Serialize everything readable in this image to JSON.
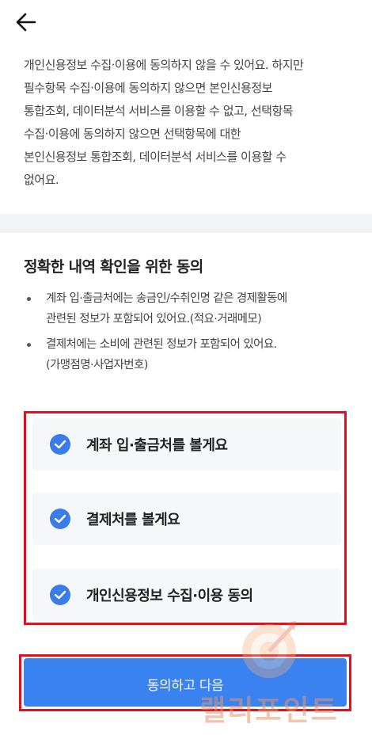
{
  "header": {
    "back_icon": "arrow-left-icon"
  },
  "notice": {
    "text": "개인신용정보 수집·이용에 동의하지 않을 수 있어요. 하지만\n필수항목 수집·이용에 동의하지 않으면 본인신용정보\n통합조회, 데이터분석 서비스를 이용할 수 없고, 선택항목\n수집·이용에 동의하지 않으면 선택항목에 대한\n본인신용정보 통합조회, 데이터분석 서비스를 이용할 수\n없어요."
  },
  "section": {
    "title": "정확한 내역 확인을 위한 동의",
    "bullets": [
      "계좌 입·출금처에는 송금인/수취인명 같은 경제활동에\n관련된 정보가 포함되어 있어요.(적요·거래메모)",
      "결제처에는 소비에 관련된 정보가 포함되어 있어요.\n(가맹점명·사업자번호)"
    ]
  },
  "agreements": [
    {
      "label": "계좌 입·출금처를 볼게요",
      "checked": true
    },
    {
      "label": "결제처를 볼게요",
      "checked": true
    },
    {
      "label": "개인신용정보 수집·이용 동의",
      "checked": true
    }
  ],
  "cta": {
    "label": "동의하고 다음"
  },
  "watermark": {
    "text": "랠리포인트"
  },
  "colors": {
    "accent": "#3a82f0",
    "check": "#3a7ce8",
    "highlight": "#e01020"
  }
}
